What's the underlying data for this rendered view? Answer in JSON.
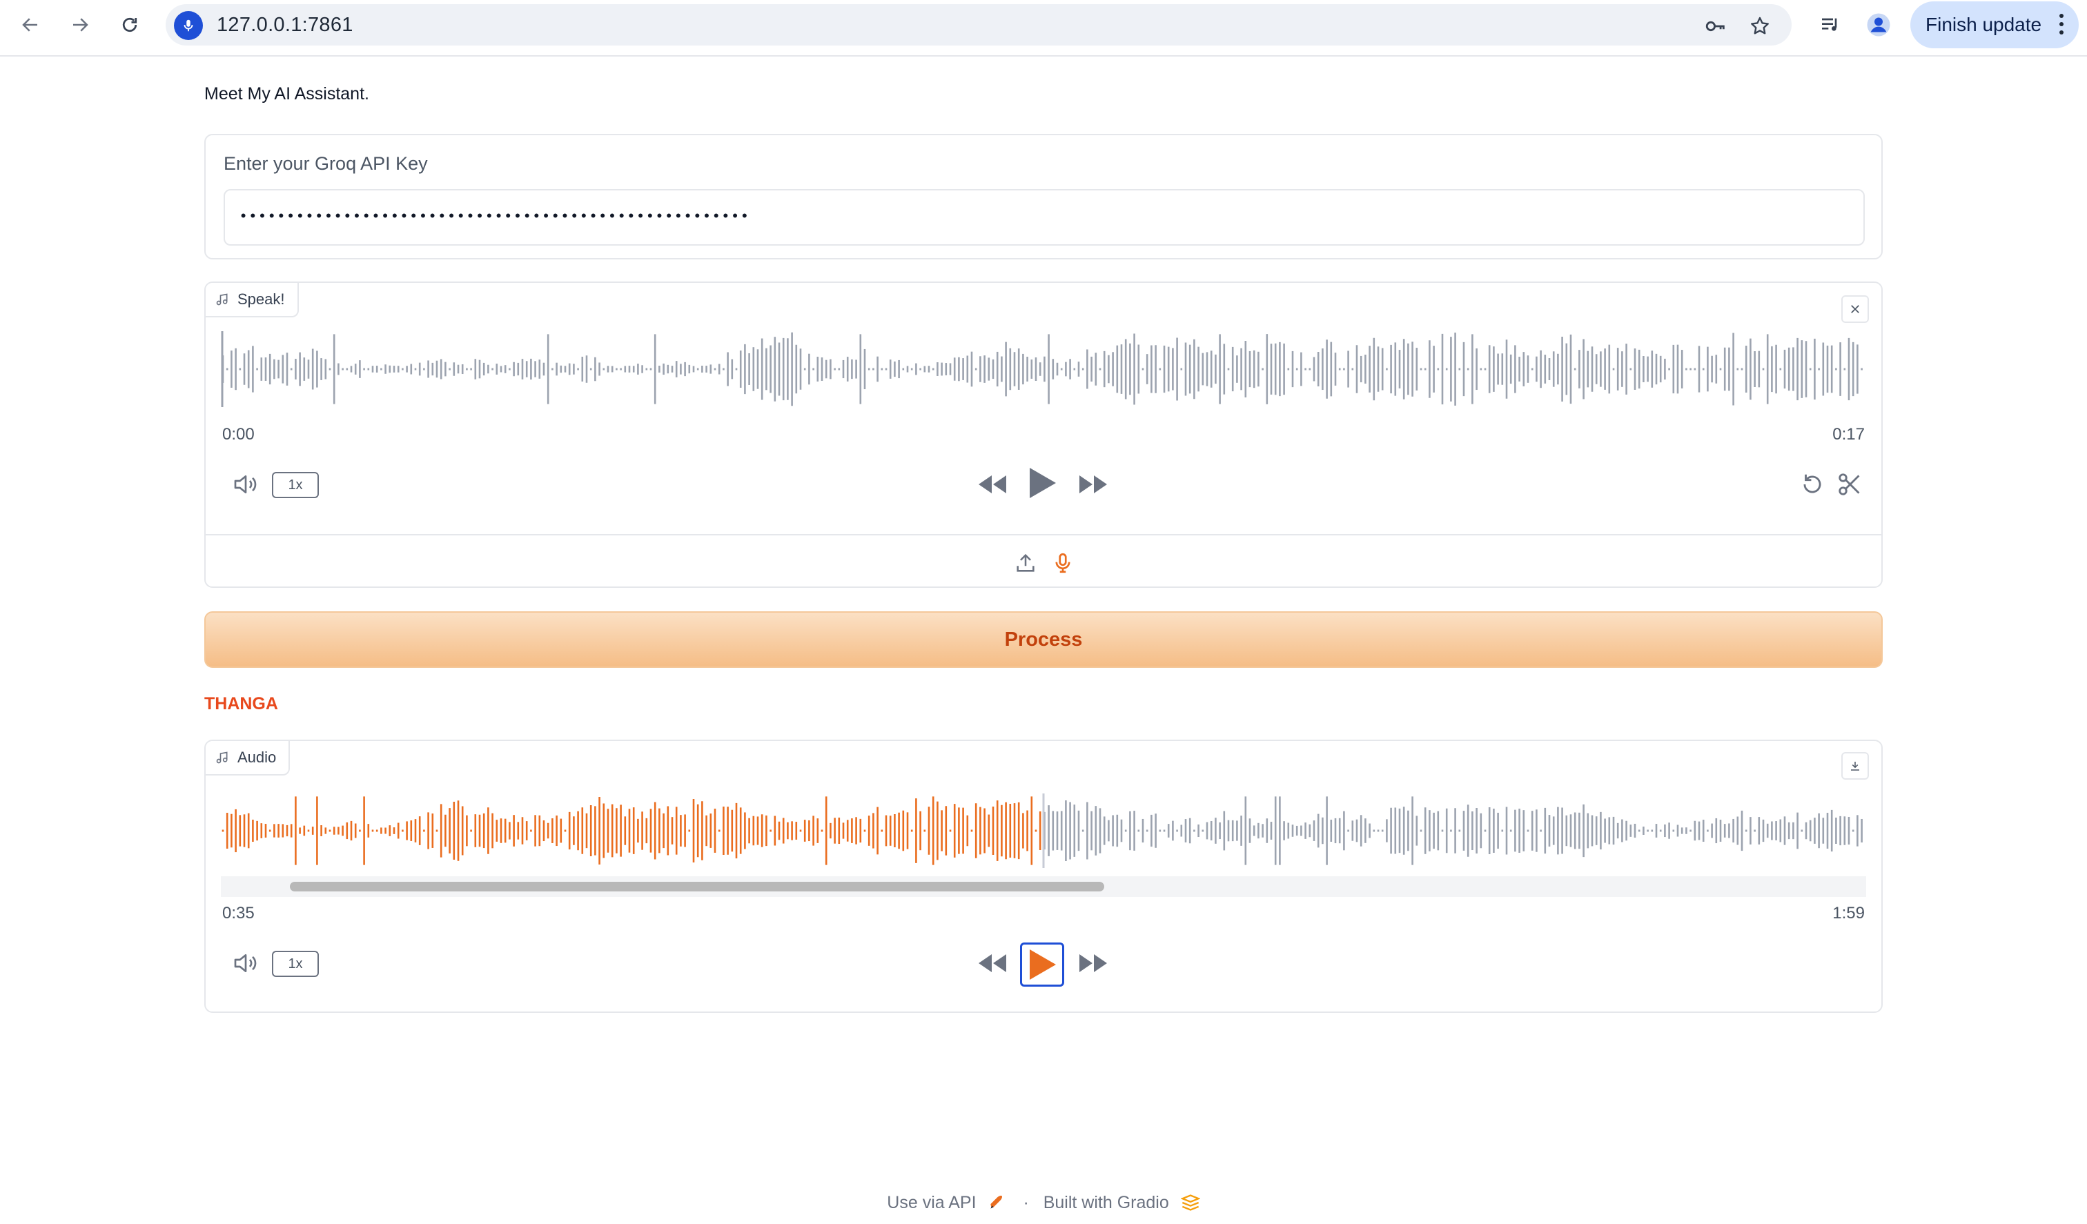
{
  "browser": {
    "url": "127.0.0.1:7861",
    "finish_update_label": "Finish update"
  },
  "page": {
    "intro": "Meet My AI Assistant.",
    "api_key": {
      "label": "Enter your Groq API Key",
      "value": "••••••••••••••••••••••••••••••••••••••••••••••••••••••"
    },
    "speak_audio": {
      "tag": "Speak!",
      "current_time": "0:00",
      "duration": "0:17",
      "speed": "1x",
      "playback_progress": 0
    },
    "process_button": "Process",
    "output_label": "THANGA",
    "output_audio": {
      "tag": "Audio",
      "current_time": "0:35",
      "duration": "1:59",
      "speed": "1x",
      "played_fraction": 0.5
    },
    "colors": {
      "accent": "#ea6d1f",
      "wave_idle": "#9ca3af",
      "process_text": "#c2410c",
      "label_red": "#e8491d"
    }
  },
  "footer": {
    "api_link": "Use via API",
    "separator": "·",
    "built_with": "Built with Gradio"
  }
}
